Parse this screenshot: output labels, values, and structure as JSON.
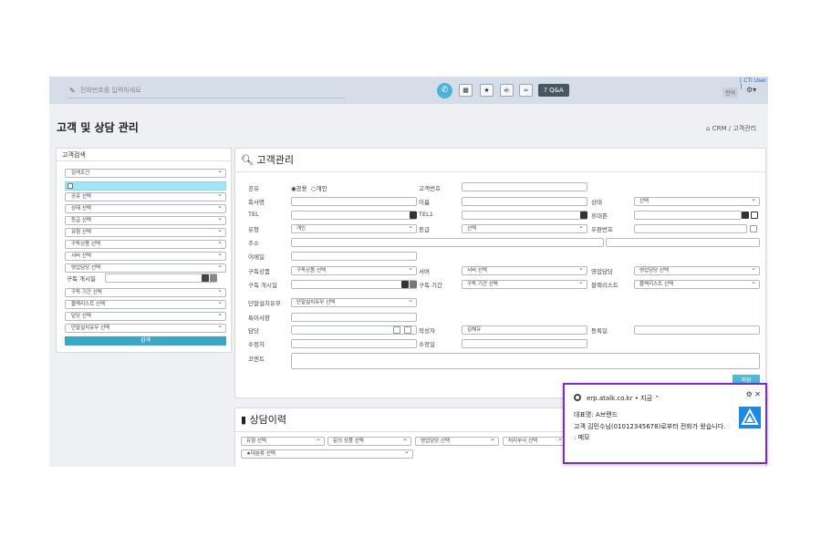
{
  "topbar": {
    "phone_placeholder": "전화번호를 입력하세요",
    "qa_label": "Q&A",
    "cti_label": "[ CTI User ]",
    "lang_label": "언어"
  },
  "page": {
    "title": "고객 및 상담 관리",
    "breadcrumb": [
      "CRM",
      "/",
      "고객관리"
    ]
  },
  "left": {
    "title": "고객검색",
    "search_condition": "검색조건",
    "selects": [
      "공유 선택",
      "상태 선택",
      "등급 선택",
      "유형 선택",
      "구독상품 선택",
      "서버 선택",
      "영업담당 선택"
    ],
    "subscribe_start_label": "구독 개시일",
    "selects2": [
      "구독 기간 선택",
      "블랙리스트 선택",
      "담당 선택",
      "단말설치유무 선택"
    ],
    "search_button": "검색"
  },
  "customer": {
    "title": "고객관리",
    "share_label": "공유",
    "share_opt1": "공용",
    "share_opt2": "개인",
    "customer_no_label": "고객번호",
    "company_label": "회사명",
    "name_label": "이름",
    "status_label": "상태",
    "status_value": "선택",
    "tel_label": "TEL",
    "tel1_label": "TEL1",
    "mobile_label": "휴대폰",
    "type_label": "유형",
    "type_value": "개인",
    "grade_label": "등급",
    "grade_value": "선택",
    "zip_label": "우편번호",
    "address_label": "주소",
    "email_label": "이메일",
    "product_label": "구독상품",
    "product_value": "구독상품 선택",
    "server_label": "서버",
    "server_value": "서버 선택",
    "sales_label": "영업담당",
    "sales_value": "영업담당 선택",
    "start_label": "구독 개시일",
    "period_label": "구독 기간",
    "period_value": "구독 기간 선택",
    "blacklist_label": "블랙리스트",
    "blacklist_value": "블랙리스트 선택",
    "device_label": "단말설치유무",
    "device_value": "단말설치유무 선택",
    "special_label": "특이사항",
    "manager_label": "담당",
    "writer_label": "작성자",
    "writer_value": "김해유",
    "regdate_label": "등록일",
    "modifier_label": "수정자",
    "moddate_label": "수정일",
    "comment_label": "코멘트",
    "save_button": "저장"
  },
  "history": {
    "title": "상담이력",
    "filters": [
      "유형 선택",
      "문의 상품 선택",
      "영업담당 선택",
      "처리부서 선택"
    ],
    "filter2": "★대분류 선택"
  },
  "notification": {
    "source": "erp.atalk.co.kr",
    "time": "지금",
    "line1": "대표명: A브랜드",
    "line2": "고객 김민수님(01012345678)로부터 전화가 왔습니다.",
    "line3": ": 메모"
  },
  "colors": {
    "accent": "#3aa8c4",
    "notif_border": "#7b2bd3",
    "topbar": "#d5dde8"
  }
}
